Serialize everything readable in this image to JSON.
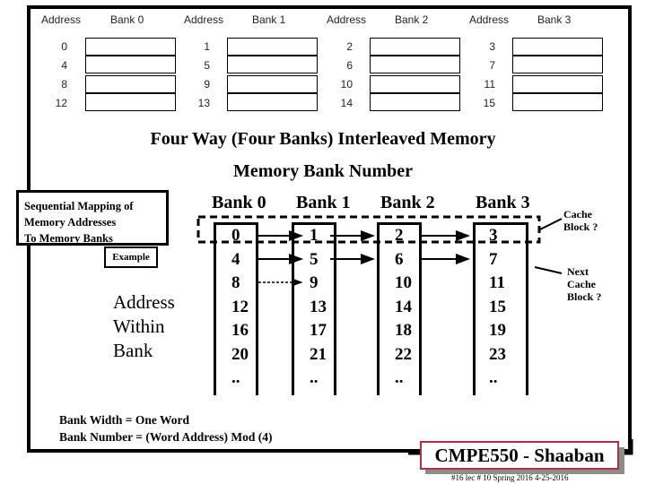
{
  "top_diagram": {
    "address_header": "Address",
    "banks": [
      {
        "label": "Bank 0",
        "addresses": [
          "0",
          "4",
          "8",
          "12"
        ]
      },
      {
        "label": "Bank 1",
        "addresses": [
          "1",
          "5",
          "9",
          "13"
        ]
      },
      {
        "label": "Bank 2",
        "addresses": [
          "2",
          "6",
          "10",
          "14"
        ]
      },
      {
        "label": "Bank 3",
        "addresses": [
          "3",
          "7",
          "11",
          "15"
        ]
      }
    ]
  },
  "title": "Four Way (Four Banks) Interleaved Memory",
  "subtitle": "Memory Bank Number",
  "callout": {
    "lines": [
      "Sequential Mapping of",
      "Memory Addresses",
      "To Memory Banks"
    ],
    "example_label": "Example"
  },
  "address_within_bank": [
    "Address",
    "Within",
    "Bank"
  ],
  "banks": [
    {
      "label": "Bank 0",
      "cells": [
        "0",
        "4",
        "8",
        "12",
        "16",
        "20",
        ".."
      ]
    },
    {
      "label": "Bank 1",
      "cells": [
        "1",
        "5",
        "9",
        "13",
        "17",
        "21",
        ".."
      ]
    },
    {
      "label": "Bank 2",
      "cells": [
        "2",
        "6",
        "10",
        "14",
        "18",
        "22",
        ".."
      ]
    },
    {
      "label": "Bank 3",
      "cells": [
        "3",
        "7",
        "11",
        "15",
        "19",
        "23",
        ".."
      ]
    }
  ],
  "notes": {
    "cache_block": [
      "Cache",
      "Block ?"
    ],
    "next_cache_block": [
      "Next",
      "Cache",
      "Block ?"
    ]
  },
  "formulas": {
    "bank_width": "Bank Width = One Word",
    "bank_number": "Bank Number = (Word Address) Mod (4)"
  },
  "badge": {
    "text": "CMPE550 - Shaaban",
    "border_color": "#b03048"
  },
  "footer": "#16  lec # 10   Spring 2016   4-25-2016"
}
